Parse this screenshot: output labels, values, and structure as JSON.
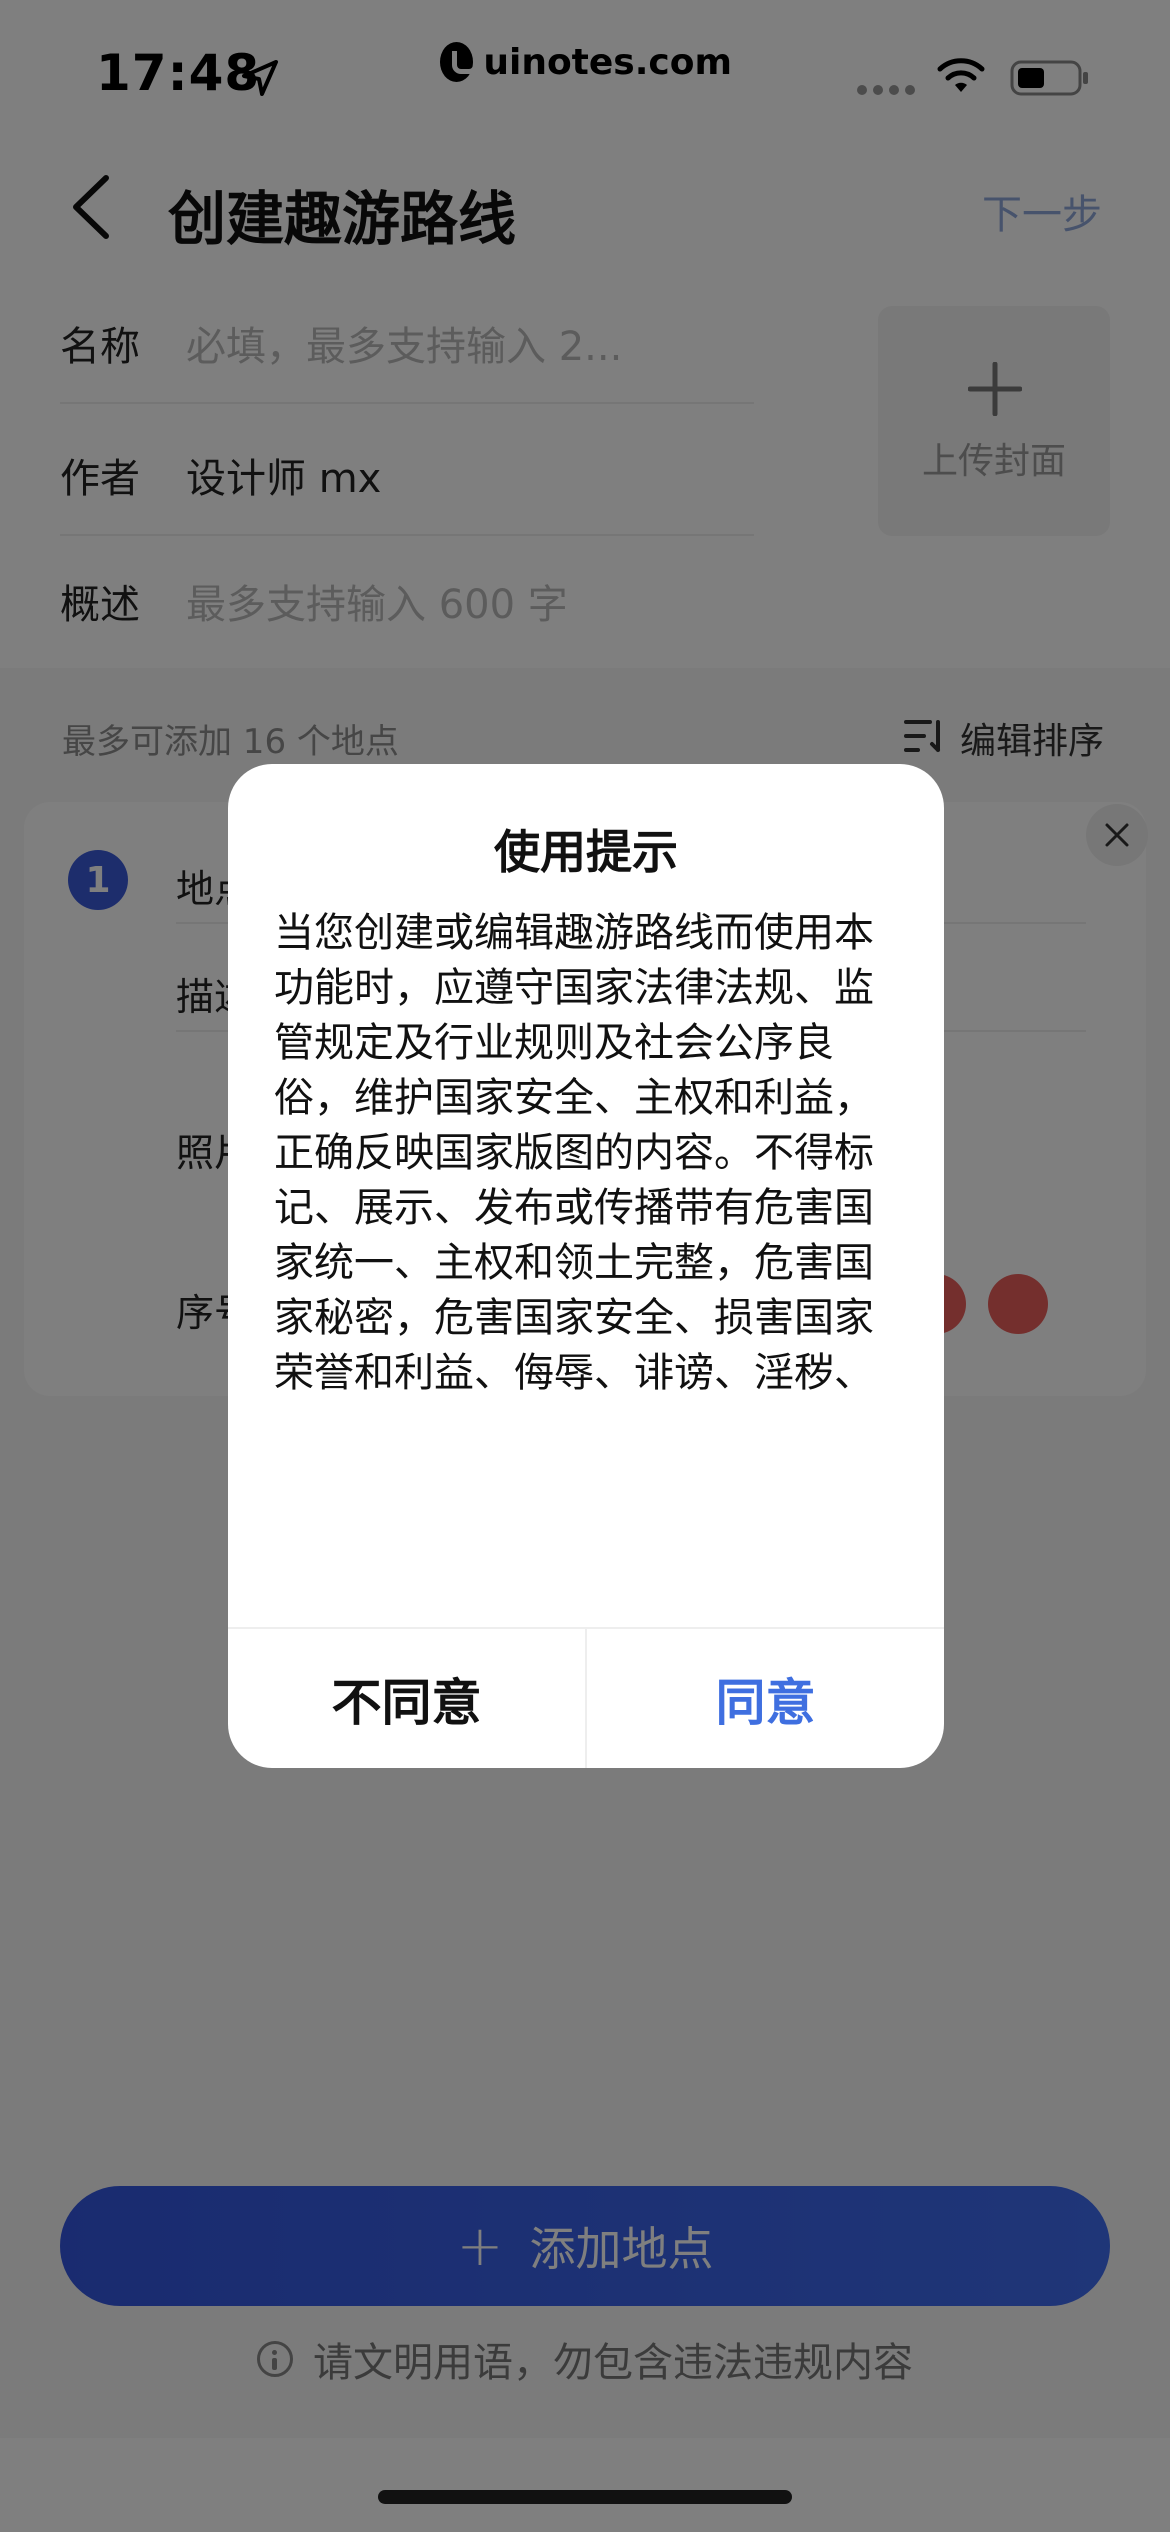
{
  "status_bar": {
    "time": "17:48",
    "watermark": "uinotes.com"
  },
  "header": {
    "title": "创建趣游路线",
    "next_label": "下一步"
  },
  "form": {
    "name_label": "名称",
    "name_placeholder": "必填，最多支持输入 2...",
    "author_label": "作者",
    "author_value": "设计师 mx",
    "summary_label": "概述",
    "summary_placeholder": "最多支持输入 600 字",
    "cover_label": "上传封面"
  },
  "places": {
    "limit_text": "最多可添加 16 个地点",
    "sort_label": "编辑排序",
    "card": {
      "index": "1",
      "field_place": "地点",
      "field_desc": "描述",
      "field_photo": "照片",
      "field_order": "序号"
    }
  },
  "add_button": {
    "label": "添加地点"
  },
  "warning": "请文明用语，勿包含违法违规内容",
  "modal": {
    "title": "使用提示",
    "body": "当您创建或编辑趣游路线而使用本功能时，应遵守国家法律法规、监管规定及行业规则及社会公序良俗，维护国家安全、主权和利益，正确反映国家版图的内容。不得标记、展示、发布或传播带有危害国家统一、主权和领土完整，危害国家秘密，危害国家安全、损害国家荣誉和利益、侮辱、诽谤、淫秽、色情、暴力、恐吓、教唆犯罪、攻击、种族歧视、中伤、骚扰、虚假、冒充、泄露隐私、恶意抄袭、侵犯",
    "disagree_label": "不同意",
    "agree_label": "同意"
  },
  "colors": {
    "accent": "#3f6fe0",
    "button_blue": "#3457e0",
    "red": "#e85f5b"
  }
}
